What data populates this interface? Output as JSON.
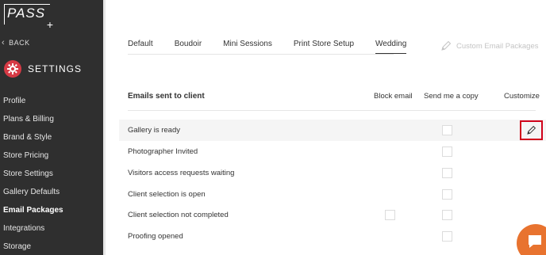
{
  "app": {
    "logo_text": "PASS",
    "logo_plus": "+"
  },
  "sidebar": {
    "back_label": "BACK",
    "settings_label": "SETTINGS",
    "items": [
      {
        "label": "Profile"
      },
      {
        "label": "Plans & Billing"
      },
      {
        "label": "Brand & Style"
      },
      {
        "label": "Store Pricing"
      },
      {
        "label": "Store Settings"
      },
      {
        "label": "Gallery Defaults"
      },
      {
        "label": "Email Packages",
        "active": true
      },
      {
        "label": "Integrations"
      },
      {
        "label": "Storage"
      }
    ]
  },
  "tabs": [
    {
      "label": "Default"
    },
    {
      "label": "Boudoir"
    },
    {
      "label": "Mini Sessions"
    },
    {
      "label": "Print Store Setup"
    },
    {
      "label": "Wedding",
      "active": true
    }
  ],
  "custom_packages_label": "Custom Email Packages",
  "table": {
    "title": "Emails sent to client",
    "col_block": "Block email",
    "col_copy": "Send me a copy",
    "col_customize": "Customize",
    "rows": [
      {
        "label": "Gallery is ready",
        "block_checkbox": false,
        "copy_checked": false,
        "customize": true
      },
      {
        "label": "Photographer Invited",
        "block_checkbox": false,
        "copy_checked": false
      },
      {
        "label": "Visitors access requests waiting",
        "block_checkbox": false,
        "copy_checked": false
      },
      {
        "label": "Client selection is open",
        "block_checkbox": false,
        "copy_checked": false
      },
      {
        "label": "Client selection not completed",
        "block_checkbox": true,
        "copy_checked": false
      },
      {
        "label": "Proofing opened",
        "block_checkbox": false,
        "copy_checked": false
      }
    ]
  },
  "colors": {
    "sidebar_bg": "#2f2f2f",
    "accent_red": "#d63a45",
    "highlight_border": "#d0021b",
    "chat_orange": "#e8732f"
  },
  "icons": {
    "settings": "gear-icon",
    "back": "chevron-left-icon",
    "custom_packages": "pencil-icon",
    "customize": "pencil-icon",
    "chat": "chat-bubble-icon"
  }
}
